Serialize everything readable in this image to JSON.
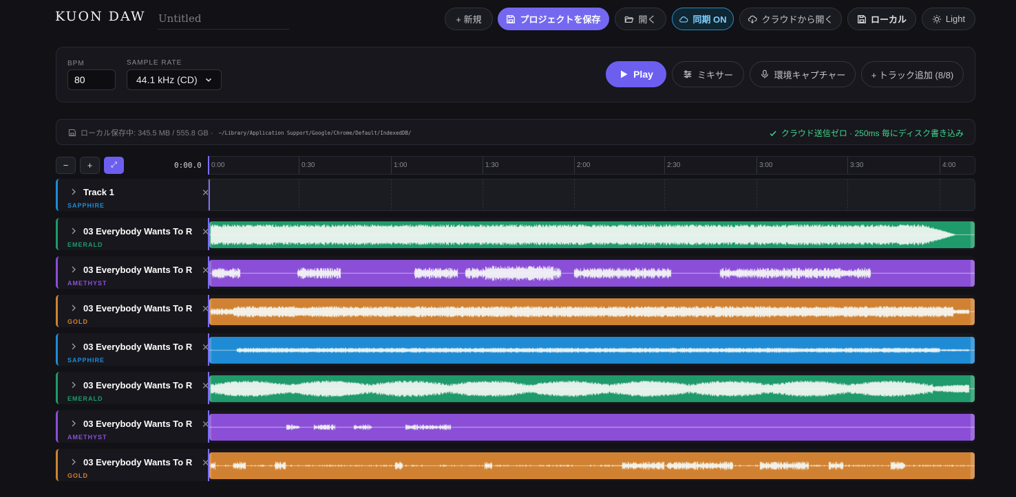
{
  "header": {
    "brand": "KUON DAW",
    "title_placeholder": "Untitled",
    "buttons": [
      {
        "id": "new",
        "label": "+ 新規",
        "icon": "plus-icon"
      },
      {
        "id": "save",
        "label": "プロジェクトを保存",
        "icon": "floppy-disk-icon"
      },
      {
        "id": "open",
        "label": "開く",
        "icon": "folder-open-icon"
      },
      {
        "id": "sync",
        "label": "同期 ON",
        "icon": "cloud-icon"
      },
      {
        "id": "cloud-open",
        "label": "クラウドから開く",
        "icon": "cloud-download-icon"
      },
      {
        "id": "local",
        "label": "ローカル",
        "icon": "floppy-disk-icon"
      },
      {
        "id": "theme",
        "label": "Light",
        "icon": "sun-icon"
      }
    ]
  },
  "transport": {
    "bpm_label": "BPM",
    "bpm_value": "80",
    "sample_rate_label": "SAMPLE RATE",
    "sample_rate_value": "44.1 kHz (CD)",
    "play_label": "Play",
    "mixer_label": "ミキサー",
    "capture_label": "環境キャプチャー",
    "add_track_label": "+ トラック追加 (8/8)"
  },
  "storage": {
    "usage_text": "ローカル保存中: 345.5 MB / 555.8 GB ·",
    "path": "~/Library/Application Support/Google/Chrome/Default/IndexedDB/",
    "status_text": "クラウド送信ゼロ · 250ms 毎にディスク書き込み"
  },
  "timeline": {
    "zoom_out": "−",
    "zoom_in": "+",
    "fit": "⤢",
    "timecode": "0:00.0",
    "ticks": [
      "0:00",
      "0:30",
      "1:00",
      "1:30",
      "2:00",
      "2:30",
      "3:00",
      "3:30",
      "4:00"
    ]
  },
  "colors": {
    "SAPPHIRE": "#1f8bd4",
    "EMERALD": "#1f9a6a",
    "AMETHYST": "#8a4fd6",
    "GOLD": "#d08232",
    "accent": "#6c5ff0"
  },
  "tracks": [
    {
      "name": "Track 1",
      "color_name": "SAPPHIRE",
      "has_clip": false,
      "profile": "none"
    },
    {
      "name": "03 Everybody Wants To R",
      "color_name": "EMERALD",
      "has_clip": true,
      "profile": "dense"
    },
    {
      "name": "03 Everybody Wants To R",
      "color_name": "AMETHYST",
      "has_clip": true,
      "profile": "phrases"
    },
    {
      "name": "03 Everybody Wants To R",
      "color_name": "GOLD",
      "has_clip": true,
      "profile": "medium"
    },
    {
      "name": "03 Everybody Wants To R",
      "color_name": "SAPPHIRE",
      "has_clip": true,
      "profile": "thin"
    },
    {
      "name": "03 Everybody Wants To R",
      "color_name": "EMERALD",
      "has_clip": true,
      "profile": "wavy"
    },
    {
      "name": "03 Everybody Wants To R",
      "color_name": "AMETHYST",
      "has_clip": true,
      "profile": "sparse"
    },
    {
      "name": "03 Everybody Wants To R",
      "color_name": "GOLD",
      "has_clip": true,
      "profile": "pulses"
    }
  ]
}
